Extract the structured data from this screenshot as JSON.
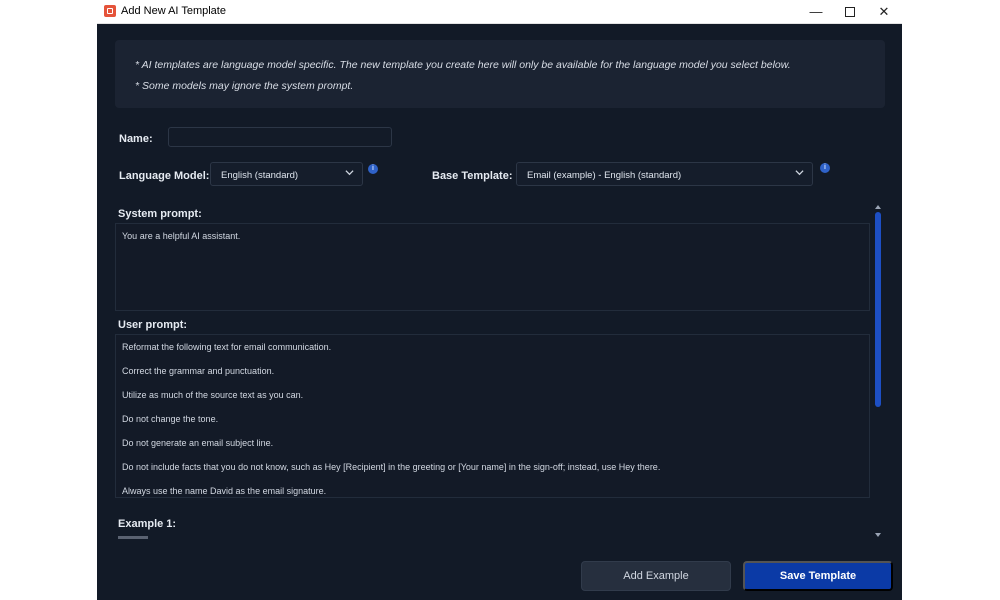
{
  "window": {
    "title": "Add New AI Template",
    "controls": {
      "minimize": "—",
      "maximize": "",
      "close": "✕"
    }
  },
  "info": {
    "line1": "* AI templates are language model specific. The new template you create here will only be available for the language model you select below.",
    "line2": "* Some models may ignore the system prompt."
  },
  "form": {
    "name_label": "Name:",
    "name_value": "",
    "language_model_label": "Language Model:",
    "language_model_value": "English (standard)",
    "base_template_label": "Base Template:",
    "base_template_value": "Email (example) - English (standard)",
    "help_glyph": "i",
    "system_prompt_label": "System prompt:",
    "system_prompt_text": "You are a helpful AI assistant.",
    "user_prompt_label": "User prompt:",
    "user_prompt_lines": [
      "Reformat the following text for email communication.",
      "Correct the grammar and punctuation.",
      "Utilize as much of the source text as you can.",
      "Do not change the tone.",
      "Do not generate an email subject line.",
      "Do not include facts that you do not know, such as Hey [Recipient] in the greeting or [Your name] in the sign-off; instead, use Hey there.",
      "Always use the name David as the email signature."
    ],
    "example_label": "Example 1:"
  },
  "buttons": {
    "add_example": "Add Example",
    "save_template": "Save Template"
  },
  "colors": {
    "background": "#121a27",
    "accent": "#0b3aa6",
    "scrollbar": "#1d4fc4"
  }
}
